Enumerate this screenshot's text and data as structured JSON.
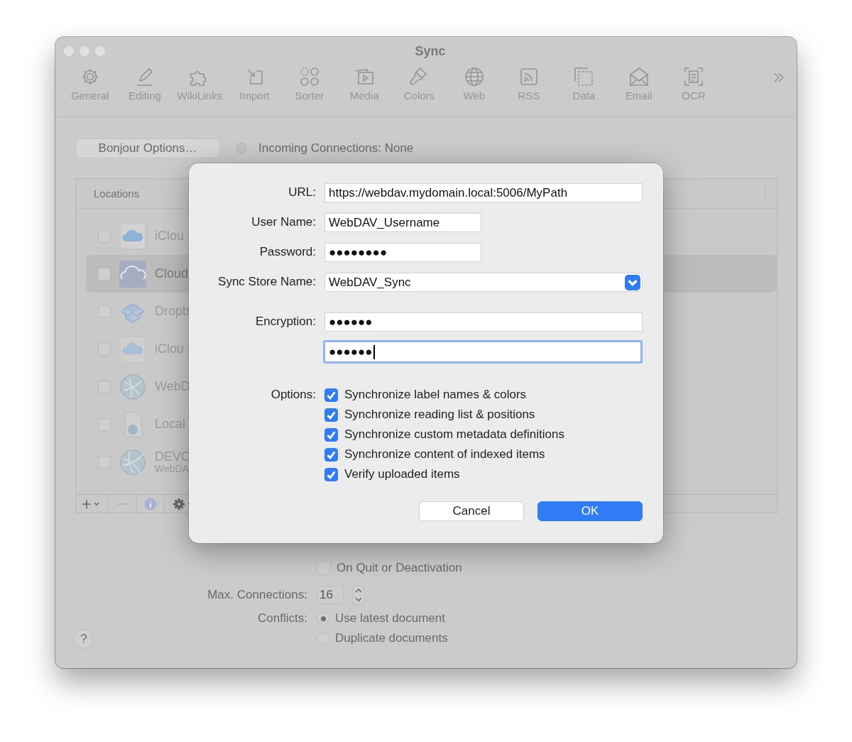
{
  "window": {
    "title": "Sync"
  },
  "toolbar": {
    "items": [
      {
        "label": "General"
      },
      {
        "label": "Editing"
      },
      {
        "label": "WikiLinks"
      },
      {
        "label": "Import"
      },
      {
        "label": "Sorter"
      },
      {
        "label": "Media"
      },
      {
        "label": "Colors"
      },
      {
        "label": "Web"
      },
      {
        "label": "RSS"
      },
      {
        "label": "Data"
      },
      {
        "label": "Email"
      },
      {
        "label": "OCR"
      }
    ]
  },
  "bonjour_button": {
    "label": "Bonjour Options…"
  },
  "incoming": {
    "label": "Incoming Connections: None"
  },
  "locations": {
    "header": "Locations",
    "rows": [
      {
        "name": "iClou",
        "checked": false,
        "selected": false
      },
      {
        "name": "Cloud",
        "checked": false,
        "selected": true
      },
      {
        "name": "Dropb",
        "checked": false,
        "selected": false
      },
      {
        "name": "iClou",
        "checked": false,
        "selected": false
      },
      {
        "name": "WebD",
        "checked": false,
        "selected": false
      },
      {
        "name": "Local",
        "checked": false,
        "selected": false
      },
      {
        "name": "DEVO",
        "subtitle": "WebDA",
        "checked": false,
        "selected": false
      }
    ]
  },
  "on_quit": {
    "label": "On Quit or Deactivation",
    "checked": false
  },
  "max_connections": {
    "label": "Max. Connections:",
    "value": "16"
  },
  "conflicts": {
    "label": "Conflicts:",
    "options": [
      {
        "label": "Use latest document",
        "selected": true
      },
      {
        "label": "Duplicate documents",
        "selected": false
      }
    ]
  },
  "help_button": {
    "label": "?"
  },
  "dialog": {
    "fields": [
      {
        "kind": "text",
        "label": "URL:",
        "value": "https://webdav.mydomain.local:5006/MyPath"
      },
      {
        "kind": "short",
        "label": "User Name:",
        "value": "WebDAV_Username"
      },
      {
        "kind": "short",
        "label": "Password:",
        "value": "●●●●●●●●"
      },
      {
        "kind": "popup",
        "label": "Sync Store Name:",
        "value": "WebDAV_Sync"
      },
      {
        "kind": "text",
        "label": "Encryption:",
        "value": "●●●●●●"
      },
      {
        "kind": "text",
        "value": "●●●●●●",
        "focused": true
      }
    ],
    "options": {
      "label": "Options:",
      "items": [
        {
          "label": "Synchronize label names & colors",
          "checked": true
        },
        {
          "label": "Synchronize reading list & positions",
          "checked": true
        },
        {
          "label": "Synchronize custom metadata definitions",
          "checked": true
        },
        {
          "label": "Synchronize content of indexed items",
          "checked": true
        },
        {
          "label": "Verify uploaded items",
          "checked": true
        }
      ]
    },
    "buttons": [
      {
        "label": "Cancel",
        "kind": "normal"
      },
      {
        "label": "OK",
        "kind": "default"
      }
    ]
  }
}
